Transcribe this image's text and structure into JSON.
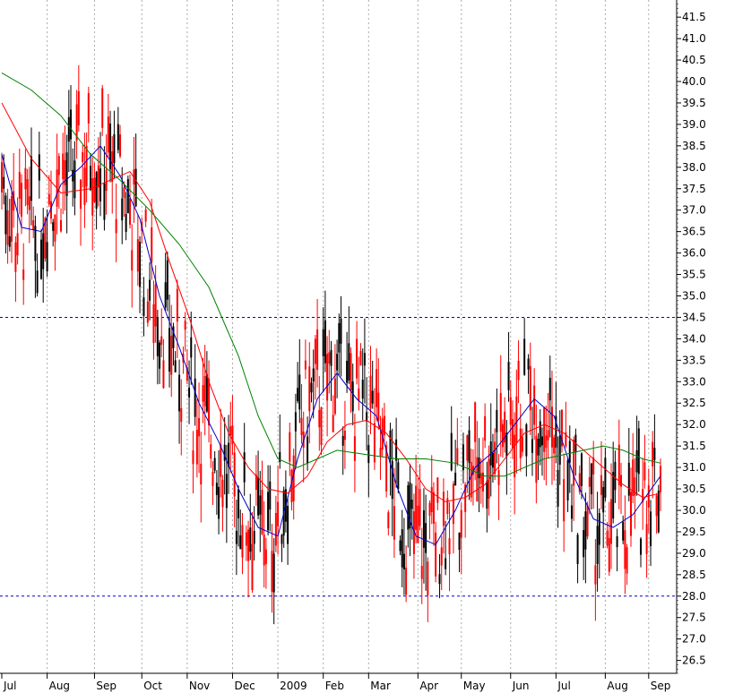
{
  "chart_data": {
    "type": "candlestick",
    "title": "",
    "xlabel": "",
    "ylabel": "",
    "ylim": [
      26.2,
      41.9
    ],
    "grid": {
      "vertical_month_lines": true,
      "horizontal": false
    },
    "y_ticks": [
      "26.5",
      "27.0",
      "27.5",
      "28.0",
      "28.5",
      "29.0",
      "29.5",
      "30.0",
      "30.5",
      "31.0",
      "31.5",
      "32.0",
      "32.5",
      "33.0",
      "33.5",
      "34.0",
      "34.5",
      "35.0",
      "35.5",
      "36.0",
      "36.5",
      "37.0",
      "37.5",
      "38.0",
      "38.5",
      "39.0",
      "39.5",
      "40.0",
      "40.5",
      "41.0",
      "41.5"
    ],
    "x_labels": [
      "Jul",
      "Aug",
      "Sep",
      "Oct",
      "Nov",
      "Dec",
      "2009",
      "Feb",
      "Mar",
      "Apr",
      "May",
      "Jun",
      "Jul",
      "Aug",
      "Sep"
    ],
    "x_label_days": [
      0,
      23,
      47,
      71,
      94,
      117,
      140,
      163,
      186,
      211,
      233,
      258,
      281,
      306,
      328
    ],
    "x_range_days": [
      0,
      334
    ],
    "reference_lines": [
      {
        "value": 34.5,
        "color": "#0000cc",
        "style": "dashed"
      },
      {
        "value": 28.0,
        "color": "#0000cc",
        "style": "dashed"
      }
    ],
    "colors": {
      "up": "#000000",
      "down": "#ff0000",
      "ma_short": "#0000cc",
      "ma_mid": "#ff0000",
      "ma_long": "#008000"
    },
    "series": [
      {
        "color": "#0000cc",
        "points": [
          [
            0,
            38.3
          ],
          [
            10,
            36.6
          ],
          [
            20,
            36.5
          ],
          [
            30,
            37.6
          ],
          [
            40,
            38.0
          ],
          [
            50,
            38.5
          ],
          [
            60,
            37.8
          ],
          [
            70,
            36.8
          ],
          [
            80,
            35.0
          ],
          [
            90,
            33.8
          ],
          [
            100,
            32.5
          ],
          [
            110,
            31.6
          ],
          [
            120,
            30.5
          ],
          [
            130,
            29.6
          ],
          [
            140,
            29.4
          ],
          [
            150,
            31.2
          ],
          [
            160,
            32.6
          ],
          [
            170,
            33.2
          ],
          [
            180,
            32.6
          ],
          [
            190,
            32.2
          ],
          [
            200,
            30.6
          ],
          [
            210,
            29.4
          ],
          [
            220,
            29.2
          ],
          [
            230,
            30.0
          ],
          [
            240,
            31.0
          ],
          [
            250,
            31.4
          ],
          [
            260,
            32.0
          ],
          [
            270,
            32.6
          ],
          [
            280,
            32.2
          ],
          [
            290,
            30.8
          ],
          [
            300,
            29.8
          ],
          [
            310,
            29.6
          ],
          [
            320,
            29.9
          ],
          [
            334,
            30.8
          ]
        ]
      },
      {
        "color": "#ff0000",
        "points": [
          [
            0,
            39.5
          ],
          [
            15,
            38.2
          ],
          [
            30,
            37.4
          ],
          [
            45,
            37.5
          ],
          [
            55,
            37.7
          ],
          [
            65,
            37.9
          ],
          [
            75,
            37.2
          ],
          [
            85,
            35.8
          ],
          [
            95,
            34.5
          ],
          [
            105,
            33.0
          ],
          [
            115,
            31.8
          ],
          [
            125,
            31.0
          ],
          [
            135,
            30.5
          ],
          [
            145,
            30.4
          ],
          [
            155,
            30.8
          ],
          [
            165,
            31.6
          ],
          [
            175,
            32.0
          ],
          [
            185,
            32.1
          ],
          [
            195,
            31.8
          ],
          [
            205,
            31.2
          ],
          [
            215,
            30.5
          ],
          [
            225,
            30.2
          ],
          [
            235,
            30.3
          ],
          [
            245,
            30.6
          ],
          [
            255,
            31.2
          ],
          [
            265,
            31.8
          ],
          [
            275,
            32.0
          ],
          [
            285,
            31.8
          ],
          [
            295,
            31.4
          ],
          [
            305,
            31.0
          ],
          [
            315,
            30.6
          ],
          [
            325,
            30.3
          ],
          [
            334,
            30.4
          ]
        ]
      },
      {
        "color": "#008000",
        "points": [
          [
            0,
            40.2
          ],
          [
            15,
            39.8
          ],
          [
            30,
            39.2
          ],
          [
            45,
            38.3
          ],
          [
            60,
            37.7
          ],
          [
            75,
            37.0
          ],
          [
            90,
            36.2
          ],
          [
            105,
            35.2
          ],
          [
            120,
            33.6
          ],
          [
            130,
            32.2
          ],
          [
            140,
            31.2
          ],
          [
            150,
            31.0
          ],
          [
            160,
            31.2
          ],
          [
            170,
            31.4
          ],
          [
            185,
            31.3
          ],
          [
            200,
            31.2
          ],
          [
            215,
            31.2
          ],
          [
            230,
            31.1
          ],
          [
            245,
            30.8
          ],
          [
            255,
            30.8
          ],
          [
            265,
            31.0
          ],
          [
            275,
            31.2
          ],
          [
            285,
            31.3
          ],
          [
            295,
            31.4
          ],
          [
            305,
            31.5
          ],
          [
            315,
            31.4
          ],
          [
            325,
            31.2
          ],
          [
            334,
            31.1
          ]
        ]
      }
    ]
  }
}
